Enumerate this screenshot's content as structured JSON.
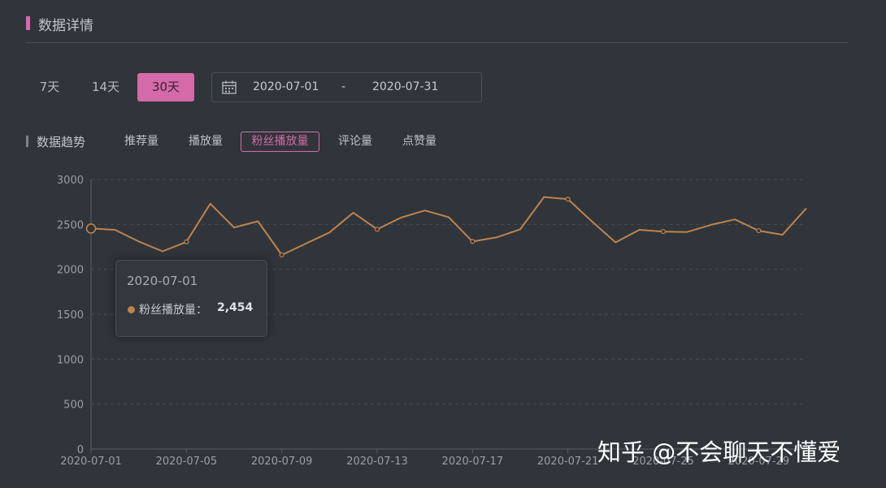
{
  "section": {
    "title": "数据详情"
  },
  "range_buttons": [
    "7天",
    "14天",
    "30天"
  ],
  "active_range": "30天",
  "date_range": {
    "start": "2020-07-01",
    "separator": "-",
    "end": "2020-07-31"
  },
  "trend": {
    "label": "数据趋势",
    "tabs": [
      "推荐量",
      "播放量",
      "粉丝播放量",
      "评论量",
      "点赞量"
    ],
    "active_tab": "粉丝播放量"
  },
  "tooltip": {
    "date": "2020-07-01",
    "series_name": "粉丝播放量：",
    "value": "2,454"
  },
  "watermark": "知乎 @不会聊天不懂爱",
  "colors": {
    "accent": "#d56aa9",
    "line": "#c0824a",
    "background": "#30353b"
  },
  "chart_data": {
    "type": "line",
    "x": [
      "2020-07-01",
      "2020-07-02",
      "2020-07-03",
      "2020-07-04",
      "2020-07-05",
      "2020-07-06",
      "2020-07-07",
      "2020-07-08",
      "2020-07-09",
      "2020-07-10",
      "2020-07-11",
      "2020-07-12",
      "2020-07-13",
      "2020-07-14",
      "2020-07-15",
      "2020-07-16",
      "2020-07-17",
      "2020-07-18",
      "2020-07-19",
      "2020-07-20",
      "2020-07-21",
      "2020-07-22",
      "2020-07-23",
      "2020-07-24",
      "2020-07-25",
      "2020-07-26",
      "2020-07-27",
      "2020-07-28",
      "2020-07-29",
      "2020-07-30",
      "2020-07-31"
    ],
    "x_tick_labels": [
      "2020-07-01",
      "2020-07-05",
      "2020-07-09",
      "2020-07-13",
      "2020-07-17",
      "2020-07-21",
      "2020-07-25",
      "2020-07-29"
    ],
    "series": [
      {
        "name": "粉丝播放量",
        "values": [
          2454,
          2440,
          2310,
          2200,
          2305,
          2730,
          2465,
          2535,
          2160,
          2285,
          2410,
          2630,
          2445,
          2575,
          2655,
          2580,
          2310,
          2355,
          2445,
          2805,
          2780,
          2535,
          2300,
          2440,
          2420,
          2415,
          2495,
          2555,
          2430,
          2385,
          2680
        ]
      }
    ],
    "ylim": [
      0,
      3000
    ],
    "y_ticks": [
      0,
      500,
      1000,
      1500,
      2000,
      2500,
      3000
    ],
    "grid": true,
    "legend": "none"
  }
}
